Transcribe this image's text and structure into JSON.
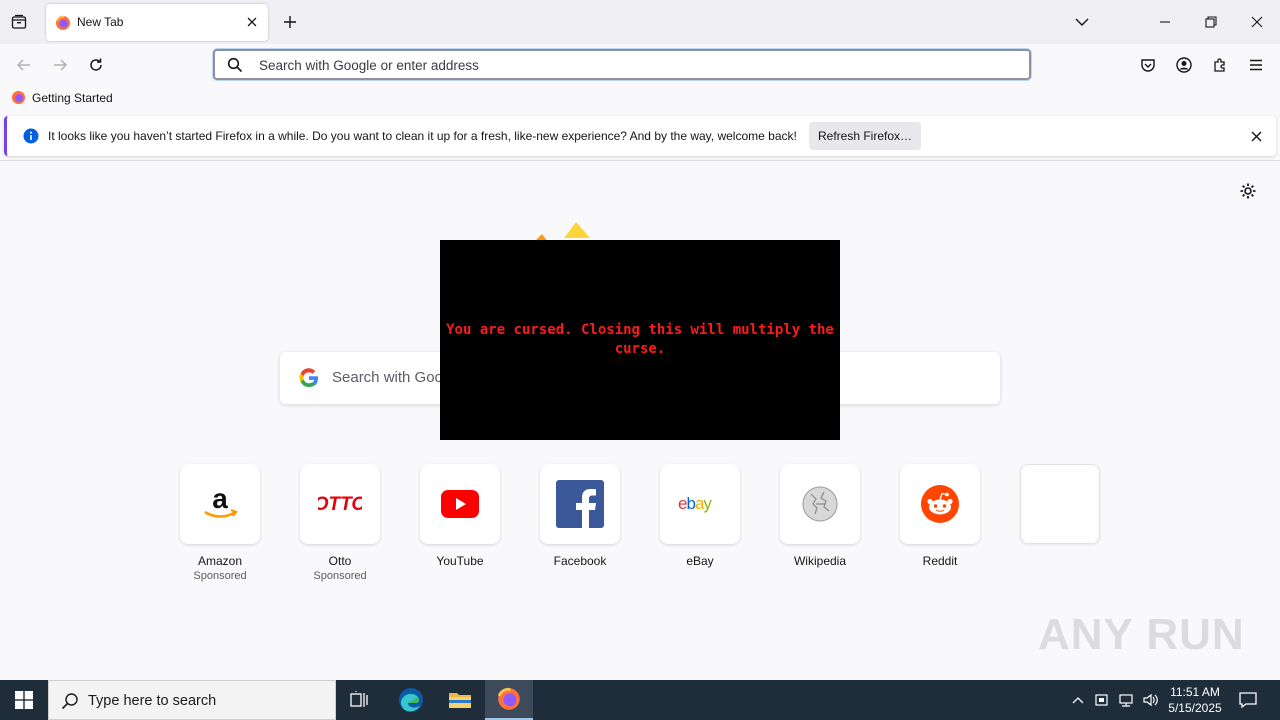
{
  "tab": {
    "title": "New Tab"
  },
  "urlbar": {
    "placeholder": "Search with Google or enter address"
  },
  "bookmarks": [
    {
      "label": "Getting Started"
    }
  ],
  "notification": {
    "message": "It looks like you haven’t started Firefox in a while. Do you want to clean it up for a fresh, like-new experience? And by the way, welcome back!",
    "button_label": "Refresh Firefox…"
  },
  "newtab": {
    "search_placeholder": "Search with Google",
    "shortcuts": [
      {
        "name": "Amazon",
        "sponsored": "Sponsored"
      },
      {
        "name": "Otto",
        "sponsored": "Sponsored"
      },
      {
        "name": "YouTube",
        "sponsored": ""
      },
      {
        "name": "Facebook",
        "sponsored": ""
      },
      {
        "name": "eBay",
        "sponsored": ""
      },
      {
        "name": "Wikipedia",
        "sponsored": ""
      },
      {
        "name": "Reddit",
        "sponsored": ""
      },
      {
        "name": "",
        "sponsored": ""
      }
    ]
  },
  "popup": {
    "message": "You are cursed. Closing this will multiply the curse."
  },
  "watermark": "ANY RUN",
  "taskbar": {
    "search_placeholder": "Type here to search",
    "time": "11:51 AM",
    "date": "5/15/2025"
  },
  "colors": {
    "accent": "#7542e5",
    "popup_text": "#ff1a1a",
    "taskbar": "#1f2c3a"
  }
}
